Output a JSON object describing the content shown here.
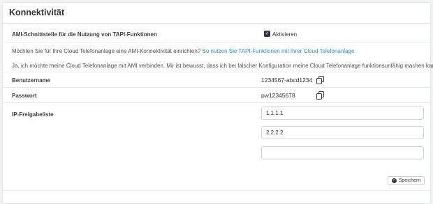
{
  "section": {
    "title": "Konnektivität"
  },
  "ami": {
    "label": "AMI-Schnittstelle für die Nutzung von TAPI-Funktionen",
    "checkbox_label": "Aktivieren",
    "checkbox_checked": true,
    "question_text": "Möchten Sie für Ihre Cloud Telefonanlage eine AMI-Konnektivität einrichten?",
    "question_link": "So nutzen Sie TAPI-Funktionen mit Ihrer Cloud Telefonanlage",
    "consent_text": "Ja, ich möchte meine Cloud Telefonanlage mit AMI verbinden. Mir ist bewusst, dass ich bei falscher Konfiguration meine Cloud Telefonanlage funktionsunfähig machen kann."
  },
  "credentials": {
    "username_label": "Benutzername",
    "username_value": "1234567-abcd1234",
    "password_label": "Passwort",
    "password_value": "pw12345678",
    "copy_icon": "copy-icon"
  },
  "ip_list": {
    "label": "IP-Freigabeliste",
    "entries": [
      "1.1.1.1",
      "2.2.2.2",
      ""
    ]
  },
  "actions": {
    "save_label": "Speichern",
    "save_icon": "check-circle-icon"
  }
}
